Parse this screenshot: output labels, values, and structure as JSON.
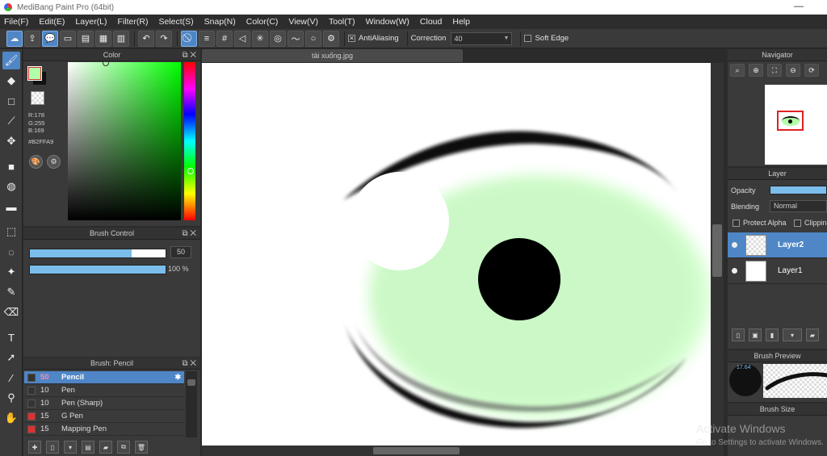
{
  "window": {
    "title": "MediBang Paint Pro (64bit)",
    "minimize": "—"
  },
  "menu": [
    "File(F)",
    "Edit(E)",
    "Layer(L)",
    "Filter(R)",
    "Select(S)",
    "Snap(N)",
    "Color(C)",
    "View(V)",
    "Tool(T)",
    "Window(W)",
    "Cloud",
    "Help"
  ],
  "toolbar": {
    "antialiasing_label": "AntiAliasing",
    "antialiasing_checked": true,
    "correction_label": "Correction",
    "correction_value": "40",
    "soft_edge_label": "Soft Edge"
  },
  "color_panel": {
    "title": "Color",
    "r": "R:178",
    "g": "G:255",
    "b": "B:169",
    "hex": "#B2FFA9",
    "fg_color": "#b2ffa9"
  },
  "brush_control": {
    "title": "Brush Control",
    "size_value": "50",
    "size_fraction": 0.75,
    "opacity_value": "100 %",
    "opacity_fraction": 1.0
  },
  "brush_list": {
    "title": "Brush: Pencil",
    "items": [
      {
        "size": "50",
        "name": "Pencil",
        "selected": true,
        "color": "#333333"
      },
      {
        "size": "10",
        "name": "Pen",
        "selected": false,
        "color": "#333333"
      },
      {
        "size": "10",
        "name": "Pen (Sharp)",
        "selected": false,
        "color": "#333333"
      },
      {
        "size": "15",
        "name": "G Pen",
        "selected": false,
        "color": "#e03030"
      },
      {
        "size": "15",
        "name": "Mapping Pen",
        "selected": false,
        "color": "#e03030"
      }
    ]
  },
  "document": {
    "tab_title": "tải xuống.jpg"
  },
  "navigator": {
    "title": "Navigator"
  },
  "layer_panel": {
    "title": "Layer",
    "opacity_label": "Opacity",
    "blending_label": "Blending",
    "blending_value": "Normal",
    "protect_alpha_label": "Protect Alpha",
    "clipping_label": "Clipping",
    "layers": [
      {
        "name": "Layer2",
        "selected": true
      },
      {
        "name": "Layer1",
        "selected": false
      }
    ]
  },
  "brush_preview": {
    "title": "Brush Preview",
    "size_text": "17.64"
  },
  "brush_size": {
    "title": "Brush Size"
  },
  "watermark": {
    "line1": "Activate Windows",
    "line2": "Go to Settings to activate Windows."
  }
}
